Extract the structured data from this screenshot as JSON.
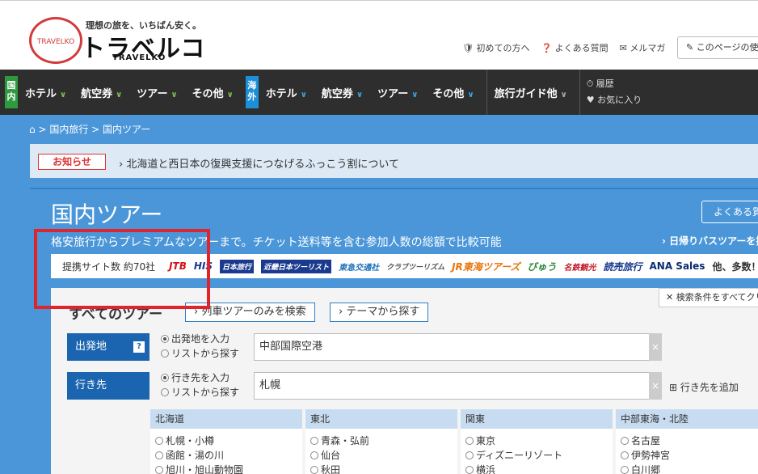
{
  "header": {
    "tagline": "理想の旅を、いちばん安く。",
    "logo_jp": "トラベルコ",
    "logo_en": "TRAVELKO",
    "logo_circle": "TRAVELKO",
    "links": [
      "初めての方へ",
      "よくある質問",
      "メルマガ"
    ],
    "page_button": "このページの使い方"
  },
  "nav": {
    "domestic_badge": "国内",
    "overseas_badge": "海外",
    "domestic": [
      "ホテル",
      "航空券",
      "ツアー",
      "その他"
    ],
    "overseas": [
      "ホテル",
      "航空券",
      "ツアー",
      "その他"
    ],
    "guide": "旅行ガイド他",
    "history": "履歴",
    "favorites": "お気に入り"
  },
  "breadcrumb": "国内旅行 > 国内ツアー",
  "notice": {
    "label": "お知らせ",
    "text": "北海道と西日本の復興支援につなげるふっこう割について"
  },
  "main": {
    "title": "国内ツアー",
    "faq": "よくある質問",
    "subtitle": "格安旅行からプレミアムなツアーまで。チケット送料等を含む参加人数の総額で比較可能",
    "bus_link": "日帰りバスツアーを探す",
    "partner_count": "提携サイト数 約70社",
    "partners": [
      "JTB",
      "HIS",
      "日本旅行",
      "近畿日本ツーリスト",
      "東急交通社",
      "クラブツーリズム",
      "JR東海ツアーズ",
      "びゅう",
      "名鉄観光",
      "読売旅行",
      "ANA Sales"
    ],
    "partners_more": "他、多数！"
  },
  "search": {
    "title": "すべてのツアー",
    "btn_train": "列車ツアーのみを検索",
    "btn_theme": "テーマから探す",
    "clear": "検索条件をすべてクリア",
    "origin_label": "出発地",
    "origin_opt1": "出発地を入力",
    "origin_opt2": "リストから探す",
    "origin_value": "中部国際空港",
    "dest_label": "行き先",
    "dest_opt1": "行き先を入力",
    "dest_opt2": "リストから探す",
    "dest_value": "札幌",
    "add_dest": "行き先を追加",
    "help": "?",
    "clear_x": "×"
  },
  "regions": [
    {
      "name": "北海道",
      "items": [
        "札幌・小樽",
        "函館・湯の川",
        "旭川・旭山動物園"
      ]
    },
    {
      "name": "東北",
      "items": [
        "青森・弘前",
        "仙台",
        "秋田"
      ]
    },
    {
      "name": "関東",
      "items": [
        "東京",
        "ディズニーリゾート",
        "横浜"
      ]
    },
    {
      "name": "中部東海・北陸",
      "items": [
        "名古屋",
        "伊勢神宮",
        "白川郷"
      ]
    }
  ]
}
